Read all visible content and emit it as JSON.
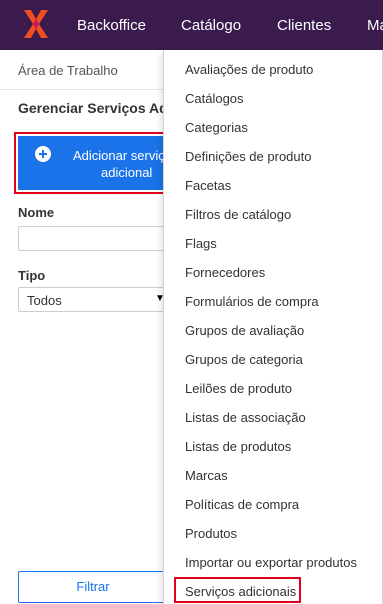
{
  "topbar": {
    "nav": [
      "Backoffice",
      "Catálogo",
      "Clientes",
      "Ma"
    ]
  },
  "breadcrumb": "Área de Trabalho",
  "page_title": "Gerenciar Serviços Adi",
  "add_button": {
    "line1": "Adicionar serviço",
    "line2": "adicional"
  },
  "form": {
    "nome_label": "Nome",
    "nome_value": "",
    "tipo_label": "Tipo",
    "tipo_value": "Todos"
  },
  "filter_button": "Filtrar",
  "dropdown_items": [
    "Avaliações de produto",
    "Catálogos",
    "Categorias",
    "Definições de produto",
    "Facetas",
    "Filtros de catálogo",
    "Flags",
    "Fornecedores",
    "Formulários de compra",
    "Grupos de avaliação",
    "Grupos de categoria",
    "Leilões de produto",
    "Listas de associação",
    "Listas de produtos",
    "Marcas",
    "Políticas de compra",
    "Produtos",
    "Importar ou exportar produtos",
    "Serviços adicionais"
  ],
  "colors": {
    "topbar": "#3b1a4e",
    "logo": "#f04e23",
    "primary": "#1a73e8",
    "highlight": "#e3001b"
  }
}
